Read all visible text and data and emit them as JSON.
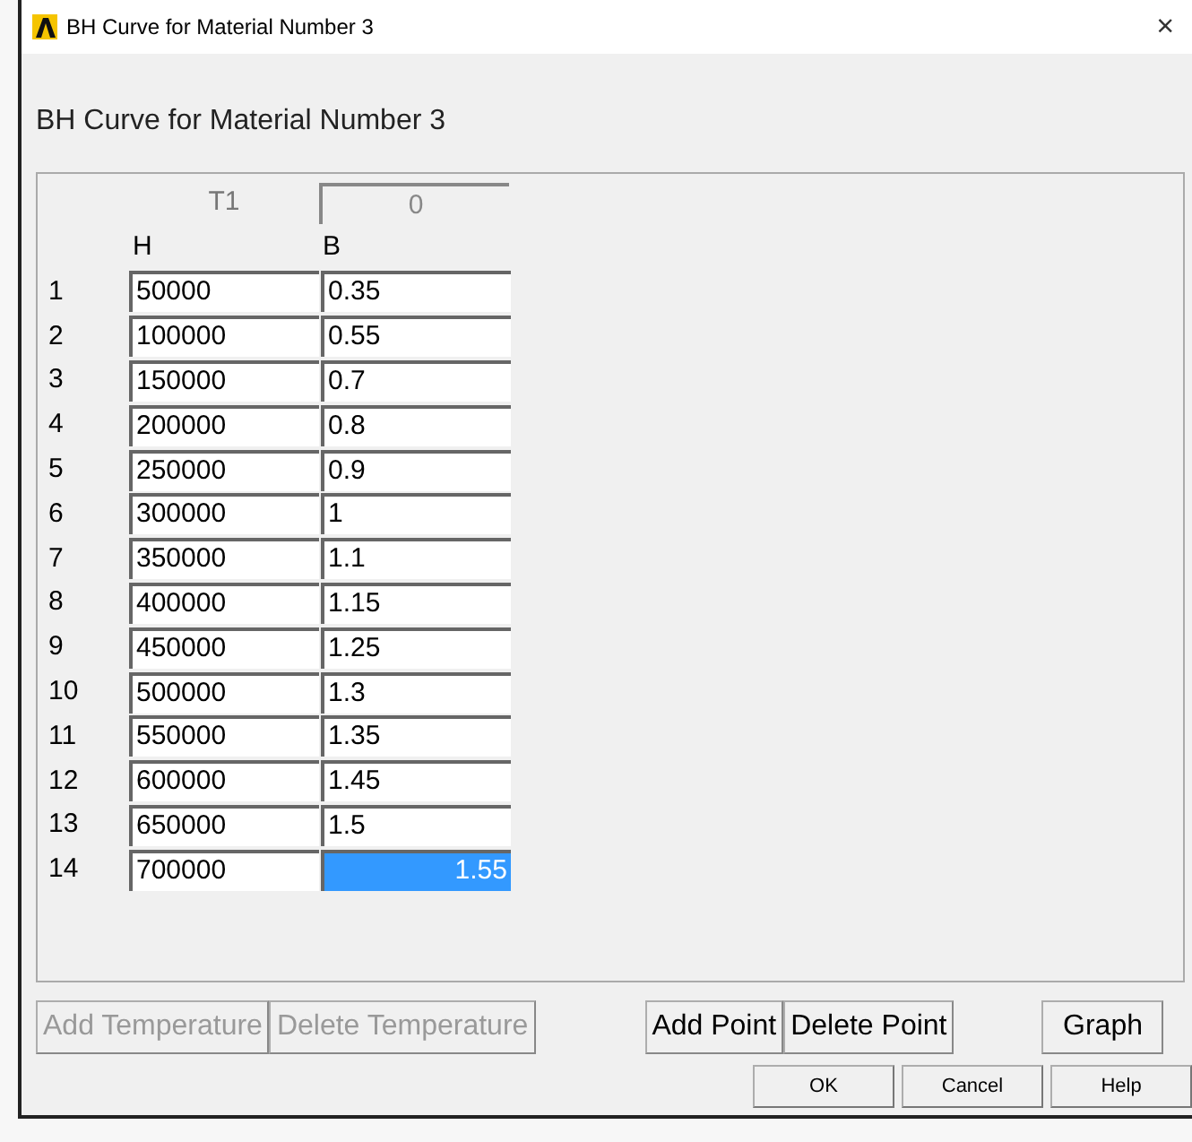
{
  "window": {
    "title": "BH Curve for Material Number 3",
    "close": "×"
  },
  "heading": "BH Curve for Material Number 3",
  "temperature": {
    "label": "T1",
    "value": "0",
    "disabled": true
  },
  "columns": [
    "H",
    "B"
  ],
  "rows": [
    {
      "index": "1",
      "h": "50000",
      "b": "0.35",
      "selected": false
    },
    {
      "index": "2",
      "h": "100000",
      "b": "0.55",
      "selected": false
    },
    {
      "index": "3",
      "h": "150000",
      "b": "0.7",
      "selected": false
    },
    {
      "index": "4",
      "h": "200000",
      "b": "0.8",
      "selected": false
    },
    {
      "index": "5",
      "h": "250000",
      "b": "0.9",
      "selected": false
    },
    {
      "index": "6",
      "h": "300000",
      "b": "1",
      "selected": false
    },
    {
      "index": "7",
      "h": "350000",
      "b": "1.1",
      "selected": false
    },
    {
      "index": "8",
      "h": "400000",
      "b": "1.15",
      "selected": false
    },
    {
      "index": "9",
      "h": "450000",
      "b": "1.25",
      "selected": false
    },
    {
      "index": "10",
      "h": "500000",
      "b": "1.3",
      "selected": false
    },
    {
      "index": "11",
      "h": "550000",
      "b": "1.35",
      "selected": false
    },
    {
      "index": "12",
      "h": "600000",
      "b": "1.45",
      "selected": false
    },
    {
      "index": "13",
      "h": "650000",
      "b": "1.5",
      "selected": false
    },
    {
      "index": "14",
      "h": "700000",
      "b": "1.55",
      "selected": true
    }
  ],
  "action_button_groups": [
    [
      {
        "label": "Add Temperature",
        "disabled": true
      },
      {
        "label": "Delete Temperature",
        "disabled": true
      }
    ],
    [
      {
        "label": "Add Point",
        "disabled": false
      },
      {
        "label": "Delete Point",
        "disabled": false
      }
    ],
    [
      {
        "label": "Graph",
        "disabled": false
      }
    ]
  ],
  "dialog_buttons": [
    "OK",
    "Cancel",
    "Help"
  ]
}
